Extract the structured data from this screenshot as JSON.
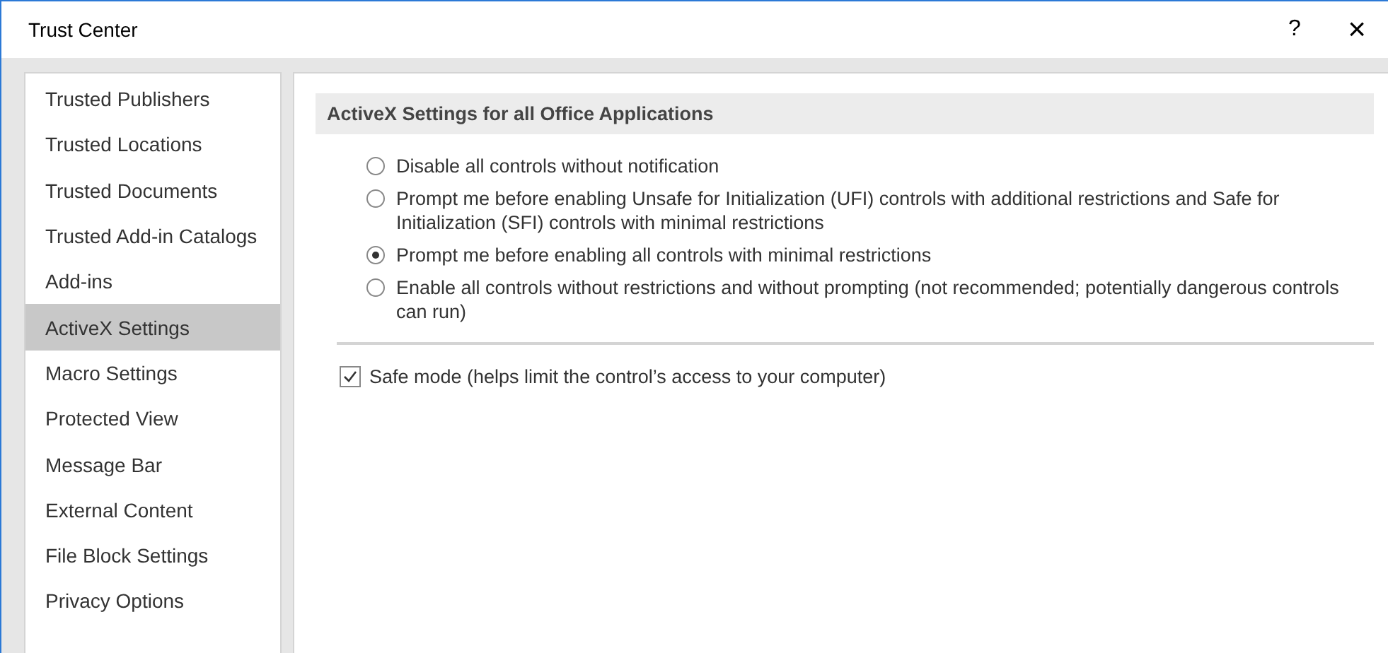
{
  "window": {
    "title": "Trust Center",
    "help": "?",
    "close": "×"
  },
  "sidebar": {
    "items": [
      {
        "label": "Trusted Publishers",
        "selected": false
      },
      {
        "label": "Trusted Locations",
        "selected": false
      },
      {
        "label": "Trusted Documents",
        "selected": false
      },
      {
        "label": "Trusted Add-in Catalogs",
        "selected": false
      },
      {
        "label": "Add-ins",
        "selected": false
      },
      {
        "label": "ActiveX Settings",
        "selected": true
      },
      {
        "label": "Macro Settings",
        "selected": false
      },
      {
        "label": "Protected View",
        "selected": false
      },
      {
        "label": "Message Bar",
        "selected": false
      },
      {
        "label": "External Content",
        "selected": false
      },
      {
        "label": "File Block Settings",
        "selected": false
      },
      {
        "label": "Privacy Options",
        "selected": false
      }
    ]
  },
  "section": {
    "heading": "ActiveX Settings for all Office Applications",
    "options": [
      {
        "label": "Disable all controls without notification",
        "selected": false
      },
      {
        "label": "Prompt me before enabling Unsafe for Initialization (UFI) controls with additional restrictions and Safe for Initialization (SFI) controls with minimal restrictions",
        "selected": false
      },
      {
        "label": "Prompt me before enabling all controls with minimal restrictions",
        "selected": true
      },
      {
        "label": "Enable all controls without restrictions and without prompting (not recommended; potentially dangerous controls can run)",
        "selected": false
      }
    ],
    "safe_mode": {
      "label": "Safe mode (helps limit the control’s access to your computer)",
      "checked": true
    }
  }
}
